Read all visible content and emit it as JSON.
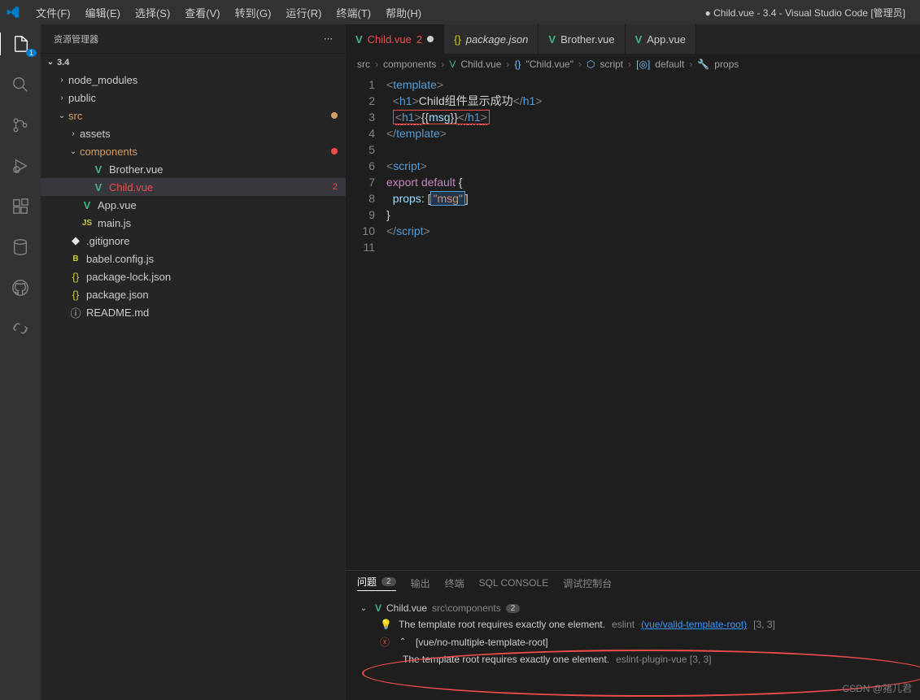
{
  "titlebar": {
    "menus": [
      "文件(F)",
      "编辑(E)",
      "选择(S)",
      "查看(V)",
      "转到(G)",
      "运行(R)",
      "终端(T)",
      "帮助(H)"
    ],
    "title": "● Child.vue - 3.4 - Visual Studio Code [管理员]"
  },
  "activity_badge": "1",
  "sidebar": {
    "title": "资源管理器",
    "root": "3.4",
    "tree": [
      {
        "indent": 1,
        "twisty": "›",
        "icon": "",
        "label": "node_modules",
        "cls": "folder-name"
      },
      {
        "indent": 1,
        "twisty": "›",
        "icon": "",
        "label": "public",
        "cls": "folder-name"
      },
      {
        "indent": 1,
        "twisty": "⌄",
        "icon": "",
        "label": "src",
        "cls": "modified",
        "dot": "mod"
      },
      {
        "indent": 2,
        "twisty": "›",
        "icon": "",
        "label": "assets",
        "cls": "folder-name"
      },
      {
        "indent": 2,
        "twisty": "⌄",
        "icon": "",
        "label": "components",
        "cls": "modified",
        "dot": "red"
      },
      {
        "indent": 3,
        "twisty": "",
        "icon": "V",
        "iconcls": "vue-icon",
        "label": "Brother.vue",
        "cls": "folder-name"
      },
      {
        "indent": 3,
        "twisty": "",
        "icon": "V",
        "iconcls": "vue-icon",
        "label": "Child.vue",
        "cls": "error-name",
        "active": true,
        "badge": "2"
      },
      {
        "indent": 2,
        "twisty": "",
        "icon": "V",
        "iconcls": "vue-icon",
        "label": "App.vue",
        "cls": "folder-name"
      },
      {
        "indent": 2,
        "twisty": "",
        "icon": "JS",
        "iconcls": "js-icon",
        "label": "main.js",
        "cls": "folder-name"
      },
      {
        "indent": 1,
        "twisty": "",
        "icon": "◆",
        "iconcls": "git-icon",
        "label": ".gitignore",
        "cls": "folder-name"
      },
      {
        "indent": 1,
        "twisty": "",
        "icon": "B",
        "iconcls": "js-icon",
        "label": "babel.config.js",
        "cls": "folder-name"
      },
      {
        "indent": 1,
        "twisty": "",
        "icon": "{}",
        "iconcls": "json-icon",
        "label": "package-lock.json",
        "cls": "folder-name"
      },
      {
        "indent": 1,
        "twisty": "",
        "icon": "{}",
        "iconcls": "json-icon",
        "label": "package.json",
        "cls": "folder-name"
      },
      {
        "indent": 1,
        "twisty": "",
        "icon": "ⓘ",
        "iconcls": "",
        "label": "README.md",
        "cls": "folder-name"
      }
    ]
  },
  "tabs": [
    {
      "icon": "V",
      "label": "Child.vue",
      "err": "2",
      "active": true,
      "modified": true
    },
    {
      "icon": "{}",
      "label": "package.json",
      "italic": true
    },
    {
      "icon": "V",
      "label": "Brother.vue"
    },
    {
      "icon": "V",
      "label": "App.vue"
    }
  ],
  "breadcrumbs": [
    "src",
    "components",
    "Child.vue",
    "\"Child.vue\"",
    "script",
    "default",
    "props"
  ],
  "crumb_icons": [
    "",
    "",
    "V",
    "{}",
    "⬡",
    "[◎]",
    "🔧"
  ],
  "code_lines": 11,
  "panel": {
    "tabs": [
      "问题",
      "输出",
      "终端",
      "SQL CONSOLE",
      "调试控制台"
    ],
    "problems_count": "2",
    "file": "Child.vue",
    "file_path": "src\\components",
    "file_count": "2",
    "items": [
      {
        "kind": "bulb",
        "msg": "The template root requires exactly one element.",
        "src": "eslint",
        "link": "(vue/valid-template-root)",
        "pos": "[3, 3]"
      },
      {
        "kind": "err",
        "rule": "[vue/no-multiple-template-root]"
      },
      {
        "kind": "text",
        "msg": "The template root requires exactly one element.",
        "src": "eslint-plugin-vue [3, 3]"
      }
    ]
  },
  "watermark": "CSDN @猪儿君"
}
